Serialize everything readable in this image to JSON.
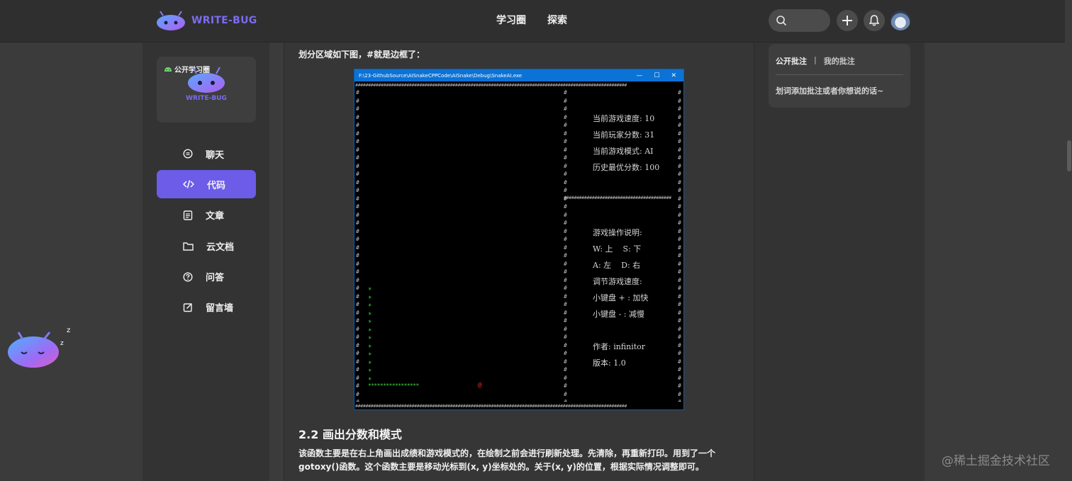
{
  "header": {
    "brand": "WRITE-BUG",
    "nav": [
      "学习圈",
      "探索"
    ],
    "icons": [
      "search-icon",
      "plus-icon",
      "bell-icon",
      "avatar"
    ]
  },
  "sidebar": {
    "card_tag": "公开学习圈",
    "card_brand": "WRITE-BUG",
    "items": [
      {
        "label": "聊天",
        "icon": "chat-icon"
      },
      {
        "label": "代码",
        "icon": "code-icon"
      },
      {
        "label": "文章",
        "icon": "article-icon"
      },
      {
        "label": "云文档",
        "icon": "folder-icon"
      },
      {
        "label": "问答",
        "icon": "question-icon"
      },
      {
        "label": "留言墙",
        "icon": "edit-icon"
      }
    ],
    "active_index": 1
  },
  "content": {
    "intro": "划分区域如下图，#就是边框了：",
    "console": {
      "title": "F:\\23-GithubSource\\AISnakeCPPCode\\AISnake\\Debug\\SnakeAI.exe",
      "window_buttons": [
        "—",
        "☐",
        "✕"
      ],
      "info_top": [
        "当前游戏速度: 10",
        "当前玩家分数: 31",
        "当前游戏模式: AI",
        "历史最优分数: 100"
      ],
      "info_bottom": [
        "游戏操作说明:",
        "W: 上    S: 下",
        "A: 左    D: 右",
        "调节游戏速度:",
        "小键盘 + : 加快",
        "小键盘 - : 减慢",
        "",
        "作者: infinitor",
        "版本: 1.0"
      ]
    },
    "heading": "2.2 画出分数和模式",
    "paragraph": "该函数主要是在右上角画出成绩和游戏模式的，在绘制之前会进行刷新处理。先清除，再重新打印。用到了一个gotoxy()函数。这个函数主要是移动光标到(x, y)坐标处的。关于(x, y)的位置，根据实际情况调整即可。"
  },
  "notes": {
    "tab_public": "公开批注",
    "separator": "|",
    "tab_mine": "我的批注",
    "hint": "划词添加批注或者你想说的话~"
  },
  "watermark": "@稀土掘金技术社区",
  "colors": {
    "accent": "#6c5ce7",
    "brand": "#7b6cf0"
  }
}
